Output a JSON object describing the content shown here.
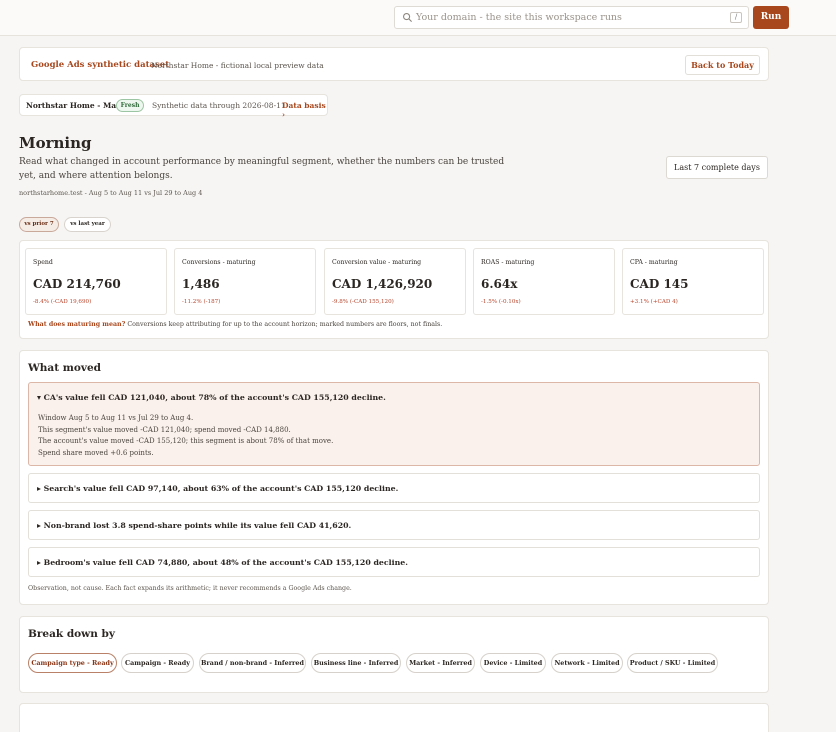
{
  "search": {
    "placeholder": "Your domain - the site this workspace runs",
    "shortcut": "/"
  },
  "run_label": "Run",
  "banner": {
    "title": "Google Ads synthetic dataset",
    "subtitle": "Northstar Home - fictional local preview data",
    "back_label": "Back to Today"
  },
  "account": {
    "name": "Northstar Home - Main",
    "freshness": "Fresh",
    "synthetic": "Synthetic data through 2026-08-11",
    "basis_link": "Data basis ›"
  },
  "page": {
    "title": "Morning",
    "subtitle": "Read what changed in account performance by meaningful segment, whether the numbers can be trusted yet, and where attention belongs.",
    "range": "northstarhome.test - Aug 5 to Aug 11 vs Jul 29 to Aug 4",
    "period_label": "Last 7 complete days"
  },
  "comparisons": [
    "vs prior 7",
    "vs last year"
  ],
  "metrics": [
    {
      "label": "Spend",
      "value": "CAD 214,760",
      "delta": "-8.4% (-CAD 19,690)"
    },
    {
      "label": "Conversions - maturing",
      "value": "1,486",
      "delta": "-11.2% (-187)"
    },
    {
      "label": "Conversion value - maturing",
      "value": "CAD 1,426,920",
      "delta": "-9.8% (-CAD 155,120)"
    },
    {
      "label": "ROAS - maturing",
      "value": "6.64x",
      "delta": "-1.5% (-0.10x)"
    },
    {
      "label": "CPA - maturing",
      "value": "CAD 145",
      "delta": "+3.1% (+CAD 4)"
    }
  ],
  "maturing_note": {
    "link": "What does maturing mean?",
    "text": " Conversions keep attributing for up to the account horizon; marked numbers are floors, not finals."
  },
  "what_moved": {
    "title": "What moved",
    "facts": [
      {
        "summary": "▾ CA's value fell CAD 121,040, about 78% of the account's CAD 155,120 decline.",
        "lines": [
          "Window Aug 5 to Aug 11 vs Jul 29 to Aug 4.",
          "This segment's value moved -CAD 121,040; spend moved -CAD 14,880.",
          "The account's value moved -CAD 155,120; this segment is about 78% of that move.",
          "Spend share moved +0.6 points."
        ]
      },
      {
        "summary": "▸ Search's value fell CAD 97,140, about 63% of the account's CAD 155,120 decline."
      },
      {
        "summary": "▸ Non-brand lost 3.8 spend-share points while its value fell CAD 41,620."
      },
      {
        "summary": "▸ Bedroom's value fell CAD 74,880, about 48% of the account's CAD 155,120 decline."
      }
    ],
    "note": "Observation, not cause. Each fact expands its arithmetic; it never recommends a Google Ads change."
  },
  "breakdown": {
    "title": "Break down by",
    "options": [
      "Campaign type - Ready",
      "Campaign - Ready",
      "Brand / non-brand - Inferred",
      "Business line - Inferred",
      "Market - Inferred",
      "Device - Limited",
      "Network - Limited",
      "Product / SKU - Limited"
    ]
  },
  "colors": {
    "accent": "#a8471d",
    "negative": "#b8442b",
    "fresh": "#2f6a3a"
  }
}
